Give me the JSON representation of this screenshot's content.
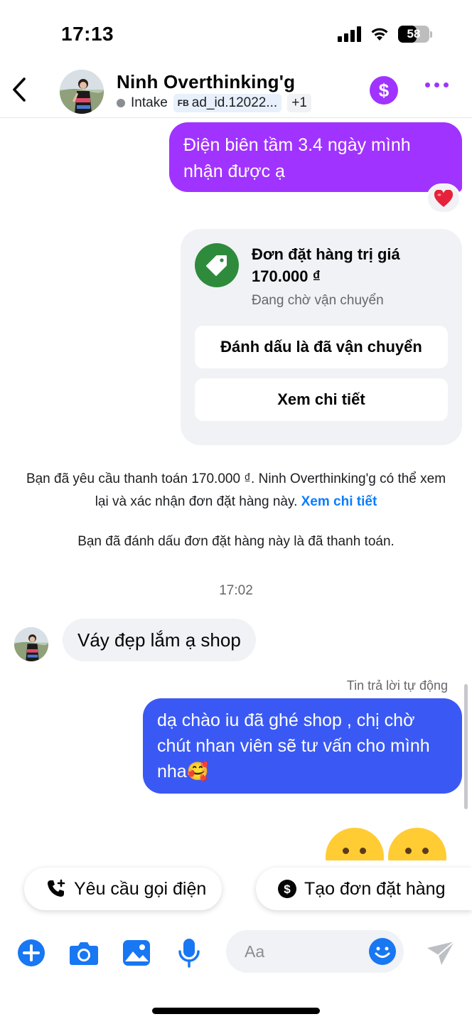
{
  "status_bar": {
    "time": "17:13",
    "battery": "58",
    "battery_level": 0.58
  },
  "header": {
    "contact_name": "Ninh Overthinking'g",
    "tag_label": "Intake",
    "ad_chip_prefix": "FB",
    "ad_chip_text": "ad_id.12022...",
    "extra_tags": "+1",
    "dollar_symbol": "$"
  },
  "messages": {
    "outgoing_1": "Điện biên tầm 3.4 ngày mình nhận được ạ",
    "order_card": {
      "title": "Đơn đặt hàng trị giá 170.000 ₫",
      "status": "Đang chờ vận chuyển",
      "mark_shipped_button": "Đánh dấu là đã vận chuyển",
      "view_details_button": "Xem chi tiết"
    },
    "system_1_text": "Bạn đã yêu cầu thanh toán 170.000 ₫. Ninh Overthinking'g có thể xem lại và xác nhận đơn đặt hàng này.",
    "system_1_link": "Xem chi tiết",
    "system_2_text": "Bạn đã đánh dấu đơn đặt hàng này là đã thanh toán.",
    "timestamp": "17:02",
    "incoming_1": "Váy đẹp lắm ạ shop",
    "auto_reply_label": "Tin trả lời tự động",
    "outgoing_2": "dạ chào iu đã ghé shop , chị chờ chút nhan viên sẽ tư vấn cho mình nha🥰"
  },
  "quick_actions": {
    "call_request": "Yêu cầu gọi điện",
    "create_order": "Tạo đơn đặt hàng"
  },
  "composer": {
    "placeholder": "Aa"
  },
  "colors": {
    "accent_purple": "#a033ff",
    "messenger_blue": "#3a59f4",
    "link_blue": "#0a7cff",
    "icon_blue": "#1877f2",
    "order_green": "#2e8b3c"
  },
  "icons": {
    "back": "chevron-left-icon",
    "more": "more-dots-icon",
    "reaction": "heart-icon",
    "order": "price-tag-icon",
    "call": "phone-plus-icon",
    "create_order": "dollar-circle-icon",
    "add": "plus-circle-icon",
    "camera": "camera-icon",
    "gallery": "image-icon",
    "mic": "microphone-icon",
    "emoji": "smiley-icon",
    "send": "send-icon"
  }
}
